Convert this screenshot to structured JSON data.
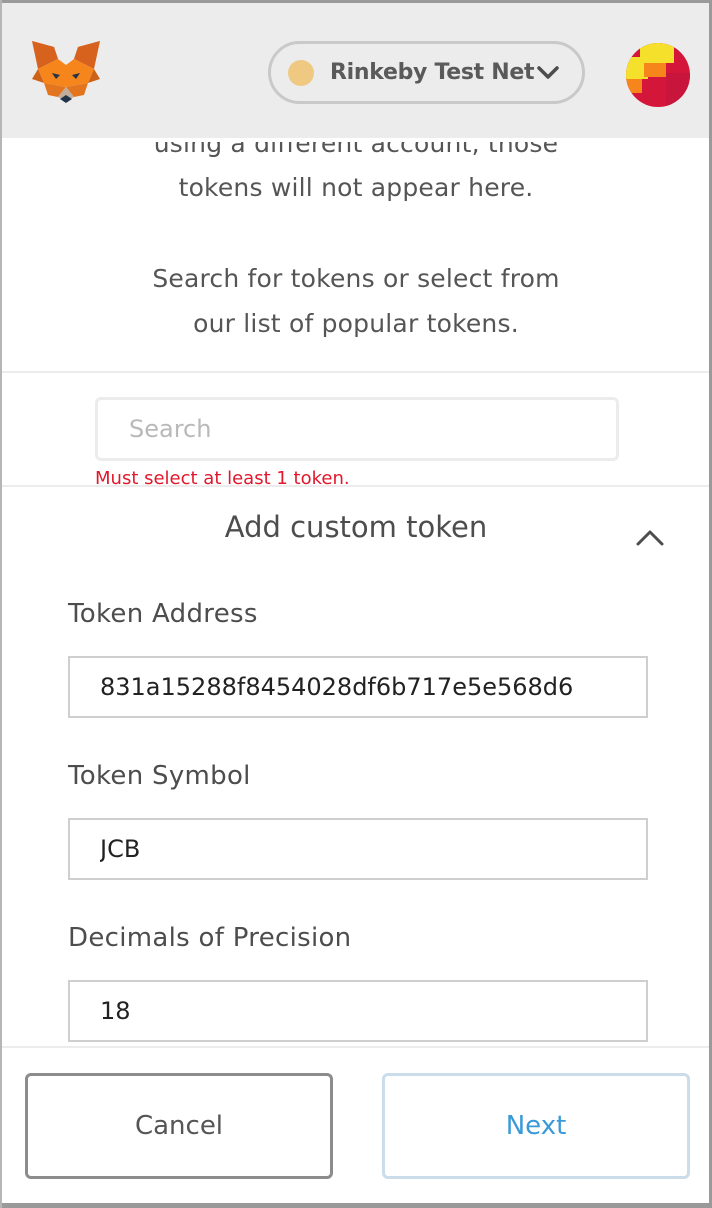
{
  "header": {
    "network_name": "Rinkeby Test Net",
    "network_dot_color": "#efc982",
    "logo_icon": "metamask-fox-icon",
    "account_icon": "account-identicon"
  },
  "intro": {
    "line1": "using a different account, those",
    "line2": "tokens will not appear here.",
    "line3": "Search for tokens or select from",
    "line4": "our list of popular tokens."
  },
  "search": {
    "placeholder": "Search",
    "error": "Must select at least 1 token."
  },
  "custom_token": {
    "title": "Add custom token",
    "collapse_icon": "chevron-up-icon",
    "address_label": "Token Address",
    "address_value": "831a15288f8454028df6b717e5e568d6",
    "symbol_label": "Token Symbol",
    "symbol_value": "JCB",
    "decimals_label": "Decimals of Precision",
    "decimals_value": "18"
  },
  "footer": {
    "cancel_label": "Cancel",
    "next_label": "Next",
    "next_color": "#3a9ad8",
    "error_color": "#e2172b"
  }
}
